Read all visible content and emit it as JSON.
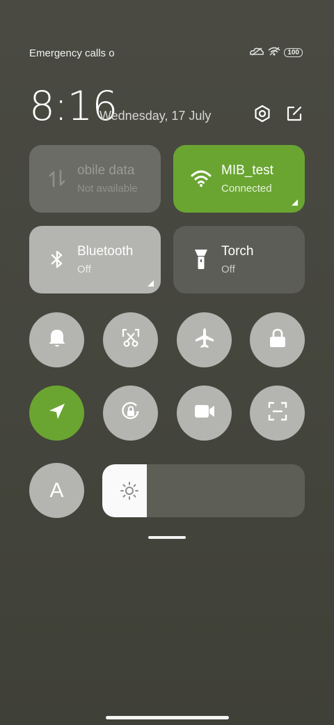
{
  "status_bar": {
    "carrier_text": "Emergency calls o",
    "battery_level": "100",
    "icons": [
      "signal-icon",
      "wifi-signal-icon",
      "battery-icon"
    ]
  },
  "header": {
    "time": "8:16",
    "date": "Wednesday, 17 July",
    "settings_icon": "settings-hex-icon",
    "edit_icon": "edit-icon"
  },
  "tiles": {
    "mobile_data": {
      "title": "obile data",
      "subtitle": "Not available",
      "icon": "mobile-data-icon",
      "state": "unavailable"
    },
    "wifi": {
      "title": "MIB_test",
      "subtitle": "Connected",
      "icon": "wifi-icon",
      "state": "on"
    },
    "bluetooth": {
      "title": "Bluetooth",
      "subtitle": "Off",
      "icon": "bluetooth-icon",
      "state": "off"
    },
    "torch": {
      "title": "Torch",
      "subtitle": "Off",
      "icon": "torch-icon",
      "state": "off"
    }
  },
  "toggles": [
    {
      "name": "notification-bell",
      "icon": "bell-icon",
      "active": false
    },
    {
      "name": "screenshot",
      "icon": "scissors-icon",
      "active": false
    },
    {
      "name": "airplane-mode",
      "icon": "airplane-icon",
      "active": false
    },
    {
      "name": "lock-screen",
      "icon": "lock-icon",
      "active": false
    },
    {
      "name": "location",
      "icon": "location-arrow-icon",
      "active": true
    },
    {
      "name": "rotation-lock",
      "icon": "rotation-lock-icon",
      "active": false
    },
    {
      "name": "screen-recorder",
      "icon": "video-camera-icon",
      "active": false
    },
    {
      "name": "scanner",
      "icon": "scan-icon",
      "active": false
    }
  ],
  "auto_brightness": {
    "label": "A"
  },
  "brightness": {
    "level": 0.22
  },
  "colors": {
    "accent_green": "#6aa532",
    "tile_gray": "#b4b5b1",
    "tile_dark": "#5c5d56"
  }
}
